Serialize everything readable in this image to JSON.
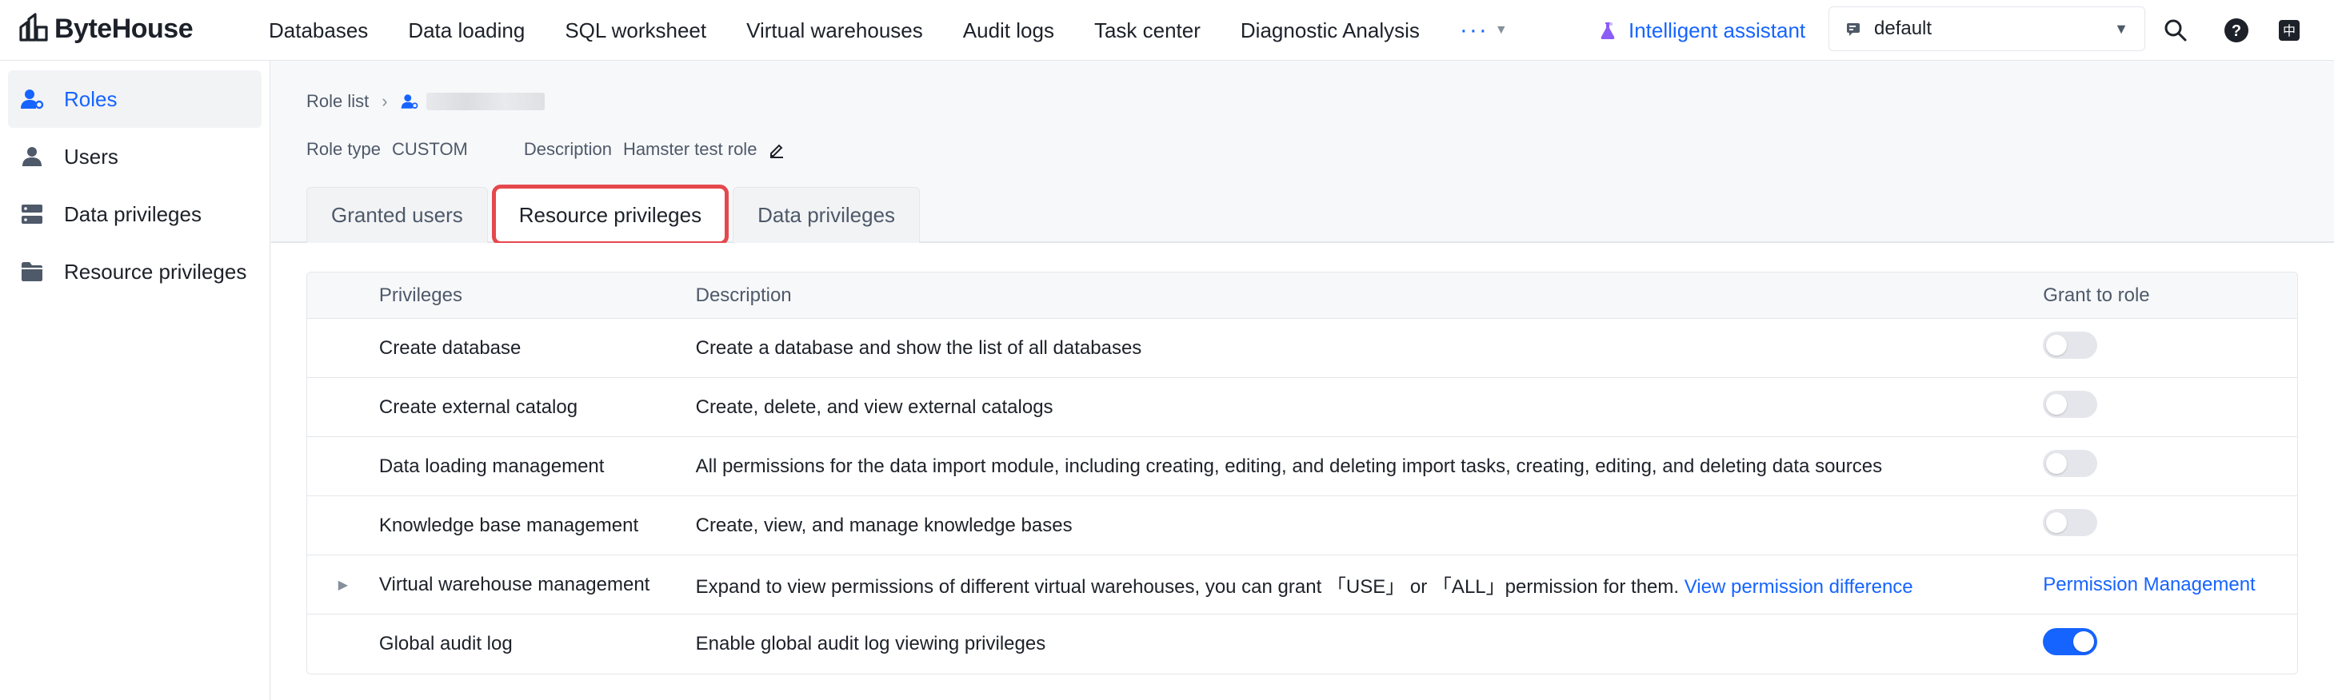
{
  "app": {
    "name": "ByteHouse"
  },
  "nav": {
    "items": [
      "Databases",
      "Data loading",
      "SQL worksheet",
      "Virtual warehouses",
      "Audit logs",
      "Task center",
      "Diagnostic Analysis"
    ],
    "more_label": "···"
  },
  "assistant": {
    "label": "Intelligent assistant"
  },
  "workspace": {
    "selected": "default"
  },
  "sidebar": {
    "items": [
      {
        "label": "Roles",
        "icon": "user-role-icon",
        "active": true
      },
      {
        "label": "Users",
        "icon": "user-icon",
        "active": false
      },
      {
        "label": "Data privileges",
        "icon": "data-privilege-icon",
        "active": false
      },
      {
        "label": "Resource privileges",
        "icon": "folder-icon",
        "active": false
      }
    ]
  },
  "breadcrumb": {
    "root": "Role list"
  },
  "role": {
    "type_label": "Role type",
    "type_value": "CUSTOM",
    "description_label": "Description",
    "description_value": "Hamster test role"
  },
  "tabs": [
    {
      "label": "Granted users",
      "active": false
    },
    {
      "label": "Resource privileges",
      "active": true
    },
    {
      "label": "Data privileges",
      "active": false
    }
  ],
  "table": {
    "headers": {
      "privileges": "Privileges",
      "description": "Description",
      "grant": "Grant to role"
    },
    "rows": [
      {
        "privilege": "Create database",
        "description": "Create a database and show the list of all databases",
        "granted": false
      },
      {
        "privilege": "Create external catalog",
        "description": "Create, delete, and view external catalogs",
        "granted": false
      },
      {
        "privilege": "Data loading management",
        "description": "All permissions for the data import module, including creating, editing, and deleting import tasks, creating, editing, and deleting data sources",
        "granted": false
      },
      {
        "privilege": "Knowledge base management",
        "description": "Create, view, and manage knowledge bases",
        "granted": false
      },
      {
        "privilege": "Virtual warehouse management",
        "description": "Expand to view permissions of different virtual warehouses, you can grant 「USE」 or 「ALL」permission for them.",
        "description_link": "View permission difference",
        "grant_link": "Permission Management",
        "expandable": true
      },
      {
        "privilege": "Global audit log",
        "description": "Enable global audit log viewing privileges",
        "granted": true
      }
    ]
  },
  "colors": {
    "accent": "#1664ff",
    "highlight": "#e5484d",
    "switch_off": "#e5e6eb"
  }
}
